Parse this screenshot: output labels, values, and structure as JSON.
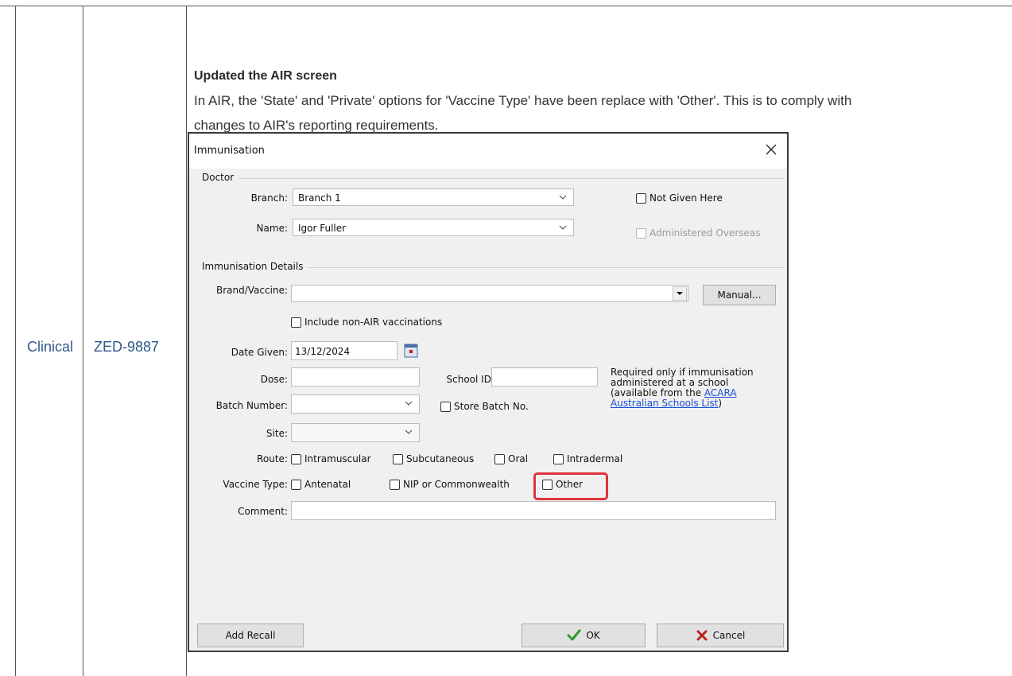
{
  "table": {
    "category": "Clinical",
    "ticket": "ZED-9887"
  },
  "note": {
    "title": "Updated the AIR screen",
    "body": "In AIR, the 'State' and 'Private' options for 'Vaccine Type' have been replace with 'Other'. This is to comply with changes to AIR's reporting requirements."
  },
  "dialog": {
    "title": "Immunisation",
    "doctor_group": "Doctor",
    "branch_label": "Branch:",
    "branch_value": "Branch 1",
    "name_label": "Name:",
    "name_value": "Igor Fuller",
    "not_given_here": "Not Given Here",
    "administered_overseas": "Administered Overseas",
    "details_group": "Immunisation Details",
    "brand_label": "Brand/Vaccine:",
    "brand_value": "",
    "manual_button": "Manual...",
    "include_non_air": "Include non-AIR vaccinations",
    "date_label": "Date Given:",
    "date_value": "13/12/2024",
    "dose_label": "Dose:",
    "dose_value": "",
    "school_id_label": "School ID:",
    "school_id_value": "",
    "school_hint_1": "Required only if immunisation",
    "school_hint_2": "administered at a school",
    "school_hint_3": "(available from the ",
    "school_hint_link_1": "ACARA",
    "school_hint_link_2": "Australian Schools List",
    "school_hint_end": ")",
    "batch_label": "Batch Number:",
    "store_batch": "Store Batch No.",
    "site_label": "Site:",
    "route_label": "Route:",
    "route_options": [
      "Intramuscular",
      "Subcutaneous",
      "Oral",
      "Intradermal"
    ],
    "vaccine_type_label": "Vaccine Type:",
    "vaccine_type_options": [
      "Antenatal",
      "NIP or Commonwealth",
      "Other"
    ],
    "comment_label": "Comment:",
    "comment_value": "",
    "add_recall_button": "Add Recall",
    "ok_button": "OK",
    "cancel_button": "Cancel"
  },
  "colors": {
    "highlight": "#e0323d",
    "ok_check": "#2e9a2e",
    "cancel_x": "#c0211b",
    "link": "#1a4fd6"
  }
}
